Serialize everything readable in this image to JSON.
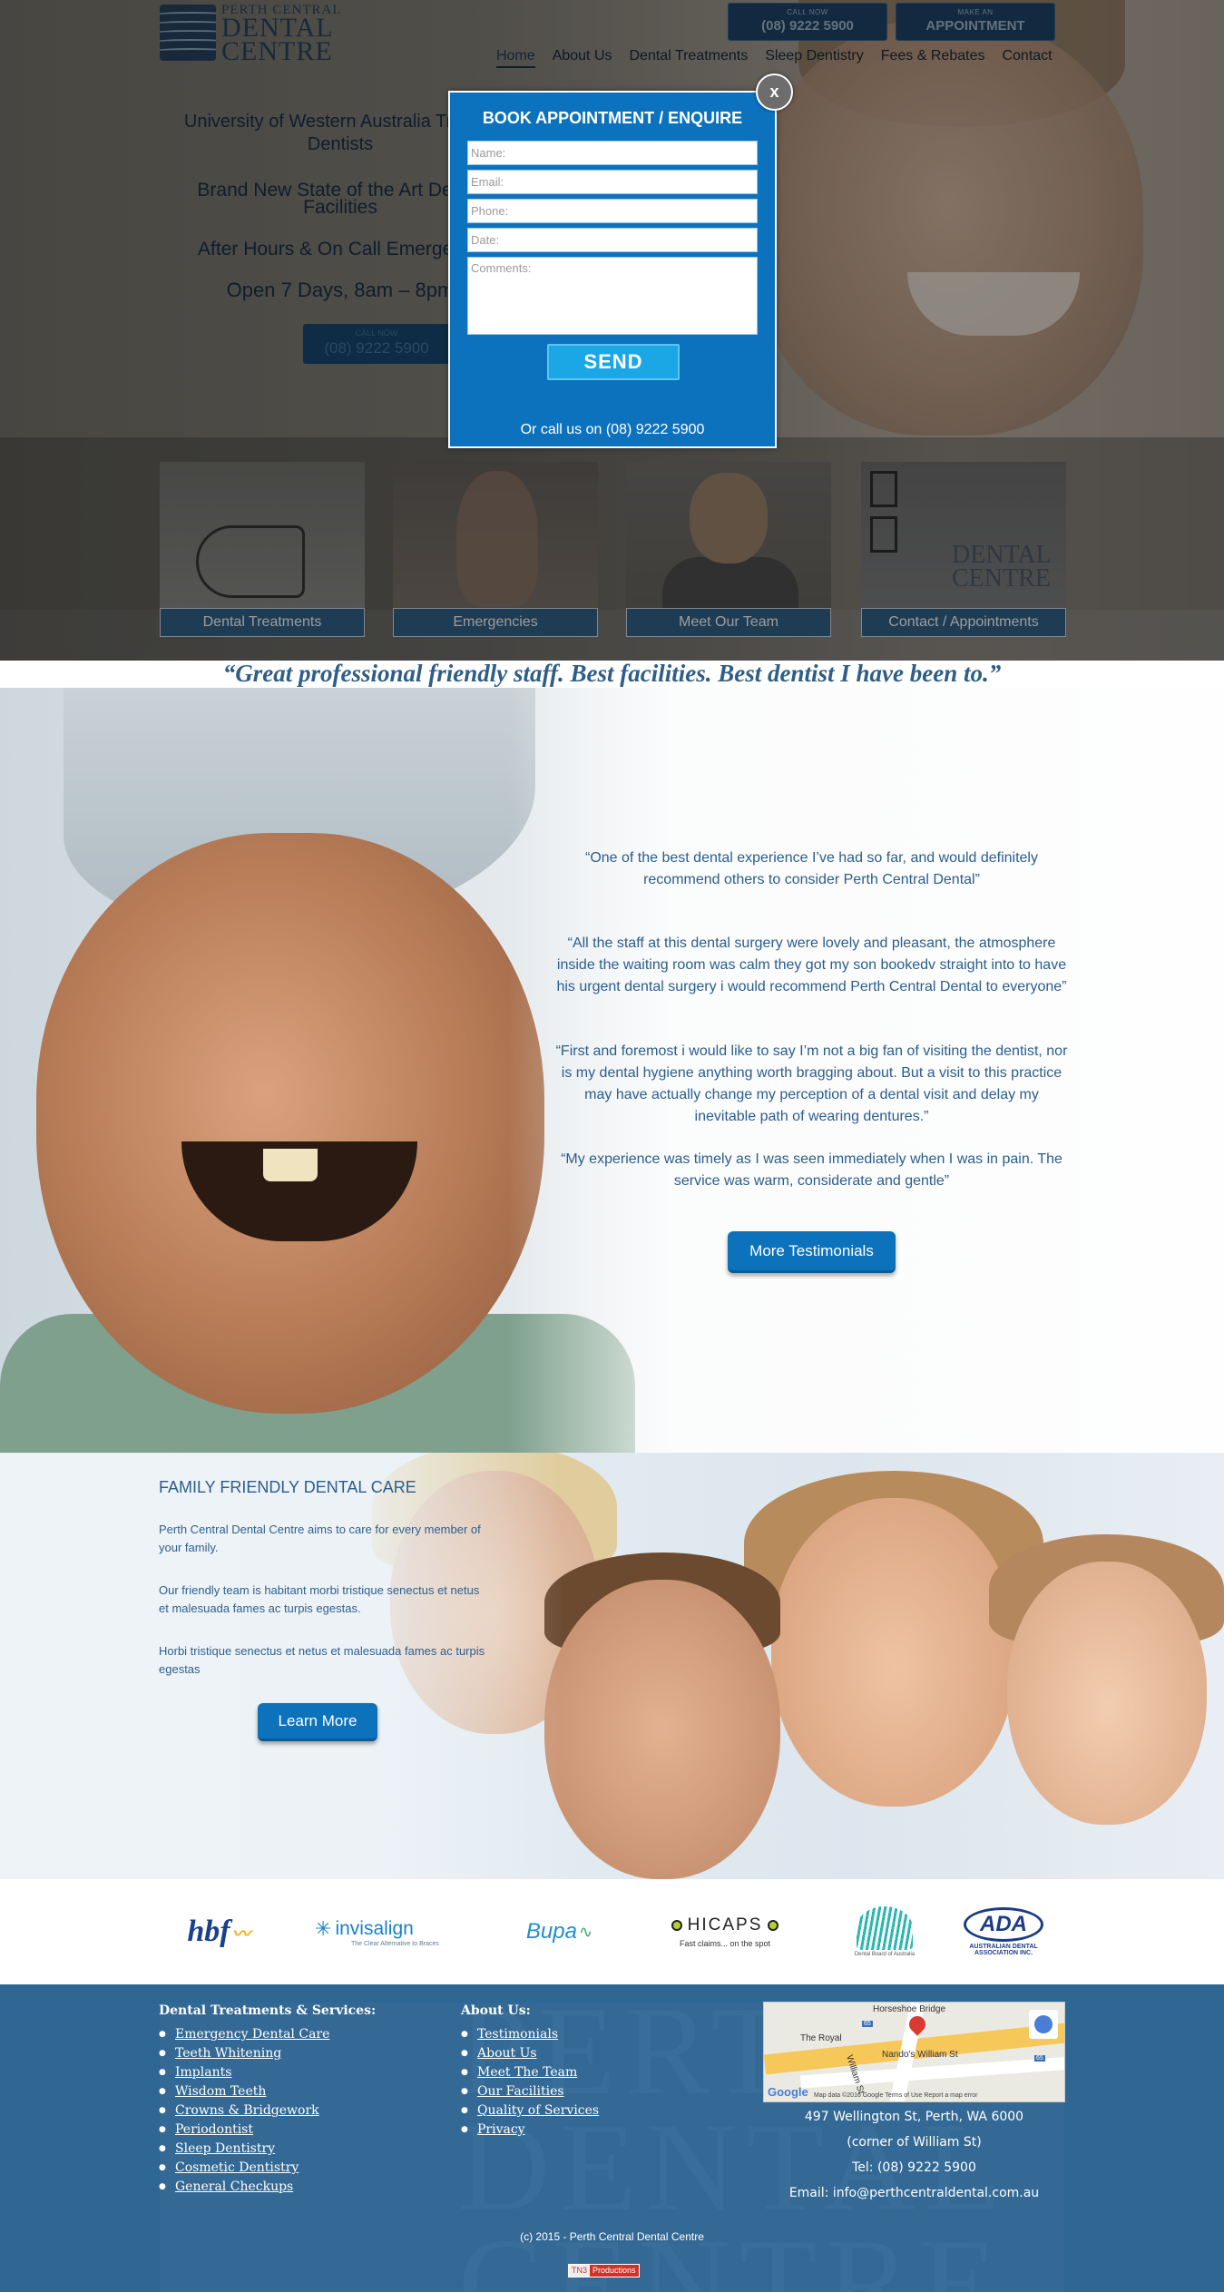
{
  "header": {
    "logo": {
      "line1": "PERTH CENTRAL",
      "line2": "DENTAL",
      "line3": "CENTRE"
    },
    "call_button": {
      "small": "CALL NOW",
      "big": "(08) 9222 5900"
    },
    "appointment_button": {
      "small": "MAKE AN",
      "big": "APPOINTMENT"
    },
    "nav": [
      "Home",
      "About Us",
      "Dental Treatments",
      "Sleep Dentistry",
      "Fees & Rebates",
      "Contact"
    ],
    "nav_active": "Home"
  },
  "hero": {
    "line1": "University of Western Australia Trained Dentists",
    "line2": "Brand New State of the Art Dental Facilities",
    "line3": "After Hours & On Call Emergency",
    "line4": "Open 7 Days, 8am – 8pm",
    "call": {
      "small": "CALL NOW",
      "big": "(08) 9222 5900"
    }
  },
  "tiles": [
    {
      "label": "Dental Treatments"
    },
    {
      "label": "Emergencies"
    },
    {
      "label": "Meet Our Team"
    },
    {
      "label": "Contact / Appointments"
    }
  ],
  "tile_sign_text": "DENTAL CENTRE",
  "headline_quote": "“Great professional friendly staff. Best facilities. Best dentist I have been to.”",
  "testimonials": [
    "“One of the best dental experience I’ve had so far, and would definitely recommend others to consider Perth Central Dental”",
    "“All the staff at this dental surgery were lovely and pleasant, the atmosphere inside the waiting room was calm they got my son bookedv straight into to have his urgent dental surgery i would recommend Perth Central Dental to everyone”",
    "“First and foremost i would like to say I’m not a big fan of visiting the dentist, nor is my dental hygiene anything worth bragging about. But a visit to this practice may have actually change my perception of a dental visit and delay my inevitable path of wearing dentures.”",
    "“My experience was timely as I was seen immediately when I was in pain. The service was warm, considerate and gentle”"
  ],
  "more_testimonials_label": "More Testimonials",
  "family": {
    "title": "FAMILY FRIENDLY DENTAL CARE",
    "p1": "Perth Central Dental Centre aims to care for every member of your family.",
    "p2": "Our friendly team is habitant morbi tristique senectus et netus et malesuada fames ac turpis egestas.",
    "p3": "Horbi tristique senectus et netus et malesuada fames ac turpis egestas",
    "button": "Learn More"
  },
  "partners": {
    "hbf": "hbf",
    "invisalign": "invisalign",
    "invisalign_tag": "The Clear Alternative to Braces",
    "bupa": "Bupa",
    "hicaps": "HICAPS",
    "hicaps_tag": "Fast claims... on the spot",
    "dental_board": "Dental Board of Australia",
    "ada": "ADA",
    "ada_tag": "AUSTRALIAN DENTAL ASSOCIATION INC."
  },
  "footer": {
    "watermark": "PERTH DENTAL CENTRE",
    "treatments_title": "Dental Treatments & Services:",
    "treatments": [
      "Emergency Dental Care",
      "Teeth Whitening",
      "Implants",
      "Wisdom Teeth",
      "Crowns & Bridgework",
      "Periodontist",
      "Sleep Dentistry",
      "Cosmetic Dentistry",
      "General Checkups"
    ],
    "about_title": "About Us:",
    "about": [
      "Testimonials",
      "About Us",
      "Meet The Team",
      "Our Facilities",
      "Quality of Services",
      "Privacy"
    ],
    "map": {
      "labels": [
        "Horseshoe Bridge",
        "The Royal",
        "Nando's William St",
        "William St"
      ],
      "shields": [
        "65",
        "65"
      ],
      "google": "Google",
      "attribution": "Map data ©2016 Google   Terms of Use   Report a map error"
    },
    "address1": "497 Wellington St, Perth, WA 6000",
    "address2": "(corner of William St)",
    "tel": "Tel: (08) 9222 5900",
    "email": "Email: info@perthcentraldental.com.au",
    "copyright": "(c) 2015 - Perth Central Dental Centre",
    "credit_a": "TN3",
    "credit_b": "Productions"
  },
  "modal": {
    "title": "BOOK APPOINTMENT / ENQUIRE",
    "name_placeholder": "Name:",
    "email_placeholder": "Email:",
    "phone_placeholder": "Phone:",
    "date_placeholder": "Date:",
    "comments_placeholder": "Comments:",
    "send": "SEND",
    "footer": "Or call us on (08) 9222 5900",
    "close": "x"
  }
}
